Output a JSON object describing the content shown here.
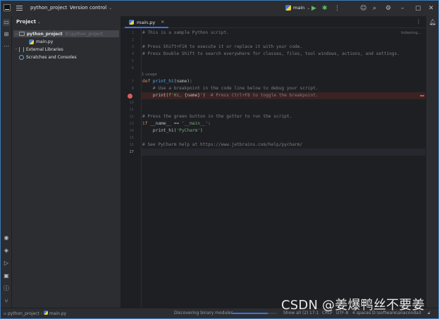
{
  "titlebar": {
    "project": "python_project",
    "version_control": "Version control",
    "run_config": "main"
  },
  "project_panel": {
    "header": "Project",
    "tree": [
      {
        "label": "python_project",
        "path": "D:\\python_project",
        "type": "folder",
        "expanded": true
      },
      {
        "label": "main.py",
        "type": "python-file"
      },
      {
        "label": "External Libraries",
        "type": "libraries",
        "expanded": false
      },
      {
        "label": "Scratches and Consoles",
        "type": "scratches"
      }
    ]
  },
  "editor": {
    "tab": "main.py",
    "status": "Indexing...",
    "usage_hint": "1 usage",
    "lines": [
      {
        "n": "1",
        "text": "# This is a sample Python script."
      },
      {
        "n": "2",
        "text": ""
      },
      {
        "n": "3",
        "text": "# Press Shift+F10 to execute it or replace it with your code."
      },
      {
        "n": "4",
        "text": "# Press Double Shift to search everywhere for classes, files, tool windows, actions, and settings."
      },
      {
        "n": "5",
        "text": ""
      },
      {
        "n": "6",
        "text": ""
      },
      {
        "n": "7",
        "text": "def print_hi(name):"
      },
      {
        "n": "8",
        "text": "    # Use a breakpoint in the code line below to debug your script."
      },
      {
        "n": "9",
        "text": "    print(f'Hi, {name}')  # Press Ctrl+F8 to toggle the breakpoint."
      },
      {
        "n": "10",
        "text": ""
      },
      {
        "n": "11",
        "text": ""
      },
      {
        "n": "12",
        "text": "# Press the green button in the gutter to run the script."
      },
      {
        "n": "13",
        "text": "if __name__ == '__main__':"
      },
      {
        "n": "14",
        "text": "    print_hi('PyCharm')"
      },
      {
        "n": "15",
        "text": ""
      },
      {
        "n": "16",
        "text": "# See PyCharm help at https://www.jetbrains.com/help/pycharm/"
      },
      {
        "n": "17",
        "text": ""
      }
    ]
  },
  "statusbar": {
    "breadcrumb_project": "python_project",
    "breadcrumb_file": "main.py",
    "task": "Discovering binary modules...",
    "show_all": "Show all (2)",
    "position": "17:1",
    "line_sep": "CRLF",
    "encoding": "UTF-8",
    "indent": "4 spaces",
    "interpreter": "D:\\software\\anaconda3",
    "progress": 0.8
  },
  "watermark": "CSDN @姜爆鸭丝不要姜"
}
